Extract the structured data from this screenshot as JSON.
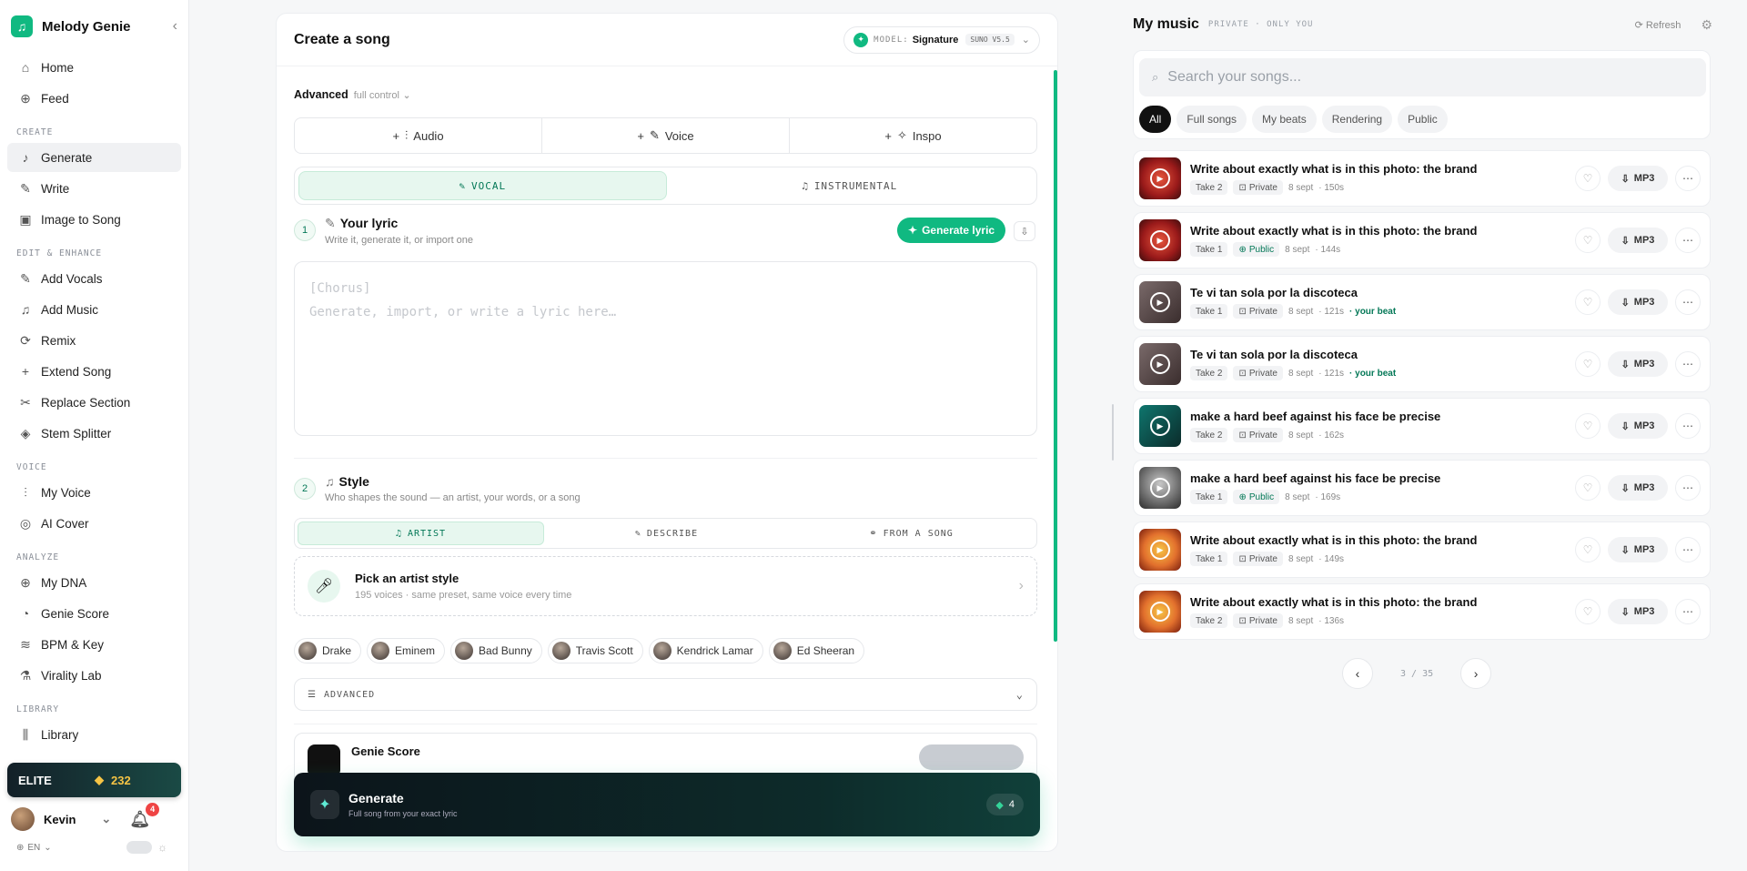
{
  "app": {
    "name": "Melody Genie"
  },
  "sidebar": {
    "nav": [
      {
        "label": "Home",
        "icon": "home-icon"
      },
      {
        "label": "Feed",
        "icon": "globe-icon"
      }
    ],
    "sections": [
      {
        "title": "CREATE",
        "items": [
          {
            "label": "Generate",
            "icon": "music-note-icon",
            "active": true
          },
          {
            "label": "Write",
            "icon": "pencil-icon"
          },
          {
            "label": "Image to Song",
            "icon": "image-icon"
          }
        ]
      },
      {
        "title": "EDIT & ENHANCE",
        "items": [
          {
            "label": "Add Vocals",
            "icon": "mic-icon"
          },
          {
            "label": "Add Music",
            "icon": "music-icon"
          },
          {
            "label": "Remix",
            "icon": "refresh-icon"
          },
          {
            "label": "Extend Song",
            "icon": "plus-icon"
          },
          {
            "label": "Replace Section",
            "icon": "scissors-icon"
          },
          {
            "label": "Stem Splitter",
            "icon": "layers-icon"
          }
        ]
      },
      {
        "title": "VOICE",
        "items": [
          {
            "label": "My Voice",
            "icon": "waveform-icon"
          },
          {
            "label": "AI Cover",
            "icon": "cover-icon"
          }
        ]
      },
      {
        "title": "ANALYZE",
        "items": [
          {
            "label": "My DNA",
            "icon": "globe-icon"
          },
          {
            "label": "Genie Score",
            "icon": "gauge-icon"
          },
          {
            "label": "BPM & Key",
            "icon": "wave-icon"
          },
          {
            "label": "Virality Lab",
            "icon": "flask-icon"
          }
        ]
      },
      {
        "title": "LIBRARY",
        "items": [
          {
            "label": "Library",
            "icon": "library-icon"
          }
        ]
      }
    ],
    "plan": {
      "label": "ELITE",
      "credits": "232"
    },
    "user": {
      "name": "Kevin",
      "notifications": "4"
    },
    "lang": "EN"
  },
  "create": {
    "title": "Create a song",
    "model": {
      "label": "MODEL:",
      "name": "Signature",
      "version": "SUNO V5.5"
    },
    "advanced": {
      "label": "Advanced",
      "sub": "full control"
    },
    "tools": [
      "Audio",
      "Voice",
      "Inspo"
    ],
    "modes": [
      {
        "label": "VOCAL",
        "active": true
      },
      {
        "label": "INSTRUMENTAL",
        "active": false
      }
    ],
    "step1": {
      "num": "1",
      "title": "Your lyric",
      "sub": "Write it, generate it, or import one",
      "button": "Generate lyric"
    },
    "lyric": {
      "line1": "[Chorus]",
      "line2": "Generate, import, or write a lyric here…"
    },
    "step2": {
      "num": "2",
      "title": "Style",
      "sub": "Who shapes the sound — an artist, your words, or a song"
    },
    "style_tabs": [
      {
        "label": "ARTIST",
        "active": true
      },
      {
        "label": "DESCRIBE",
        "active": false
      },
      {
        "label": "FROM A SONG",
        "active": false
      }
    ],
    "artist_card": {
      "title": "Pick an artist style",
      "sub": "195 voices · same preset, same voice every time"
    },
    "artists": [
      "Drake",
      "Eminem",
      "Bad Bunny",
      "Travis Scott",
      "Kendrick Lamar",
      "Ed Sheeran"
    ],
    "advanced_section": "ADVANCED",
    "genie_score": "Genie Score",
    "generate": {
      "title": "Generate",
      "sub": "Full song from your exact lyric",
      "cost": "4"
    }
  },
  "music": {
    "title": "My music",
    "sub": "PRIVATE · ONLY YOU",
    "refresh": "Refresh",
    "search_placeholder": "Search your songs...",
    "filters": [
      {
        "label": "All",
        "active": true
      },
      {
        "label": "Full songs"
      },
      {
        "label": "My beats"
      },
      {
        "label": "Rendering"
      },
      {
        "label": "Public"
      }
    ],
    "songs": [
      {
        "title": "Write about exactly what is in this photo: the brand",
        "take": "Take 2",
        "vis": "Private",
        "date": "8 sept",
        "dur": "· 150s",
        "beat": "",
        "thumb": "red"
      },
      {
        "title": "Write about exactly what is in this photo: the brand",
        "take": "Take 1",
        "vis": "Public",
        "date": "8 sept",
        "dur": "· 144s",
        "beat": "",
        "thumb": "red"
      },
      {
        "title": "Te vi tan sola por la discoteca",
        "take": "Take 1",
        "vis": "Private",
        "date": "8 sept",
        "dur": "· 121s",
        "beat": "· your beat",
        "thumb": "photo"
      },
      {
        "title": "Te vi tan sola por la discoteca",
        "take": "Take 2",
        "vis": "Private",
        "date": "8 sept",
        "dur": "· 121s",
        "beat": "· your beat",
        "thumb": "photo"
      },
      {
        "title": "make a hard beef against his face be precise",
        "take": "Take 2",
        "vis": "Private",
        "date": "8 sept",
        "dur": "· 162s",
        "beat": "",
        "thumb": "teal"
      },
      {
        "title": "make a hard beef against his face be precise",
        "take": "Take 1",
        "vis": "Public",
        "date": "8 sept",
        "dur": "· 169s",
        "beat": "",
        "thumb": "face"
      },
      {
        "title": "Write about exactly what is in this photo: the brand",
        "take": "Take 1",
        "vis": "Private",
        "date": "8 sept",
        "dur": "· 149s",
        "beat": "",
        "thumb": "gold"
      },
      {
        "title": "Write about exactly what is in this photo: the brand",
        "take": "Take 2",
        "vis": "Private",
        "date": "8 sept",
        "dur": "· 136s",
        "beat": "",
        "thumb": "gold"
      }
    ],
    "mp3_label": "MP3",
    "pager": "3 / 35"
  }
}
